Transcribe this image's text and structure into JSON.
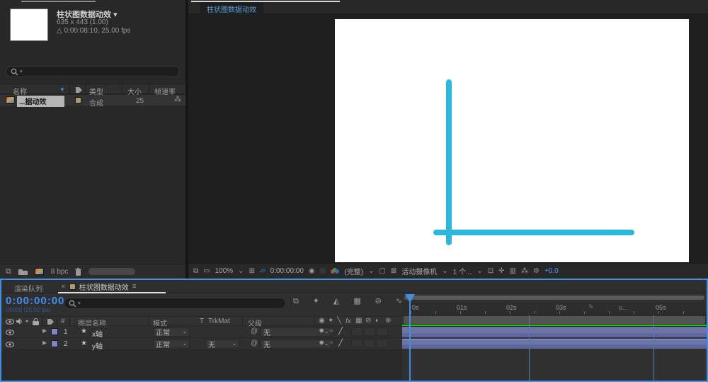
{
  "icons": {
    "caret_down": "▾",
    "chevron": "⌄",
    "sort_desc": "▼",
    "warn": "△",
    "expand": "▶",
    "star": "★",
    "pickwhip": "@",
    "hash": "#",
    "dual_view": "⧉",
    "monitor": "▭",
    "region": "⊞",
    "safe_guides": "▱",
    "snapshot": "◉",
    "show_snapshot": "◎",
    "box": "▢",
    "checker": "⊠",
    "roi": "⊡",
    "target": "✛",
    "columns": "▥",
    "network": "⁂",
    "gear": "⚙",
    "flowchart": "⧉",
    "draft3d": "✦",
    "shy_tl": "◭",
    "frame_blend": "▦",
    "motion_blur": "⊘",
    "graph": "∿",
    "menu": "≡",
    "close": "✕",
    "quality": "╱",
    "fx": "fx",
    "adjust": "◐",
    "cube": "⊕",
    "collapse": "✸",
    "solo": "●",
    "shy_head": "◉",
    "marker_pen": "✎"
  },
  "colors": {
    "accent_blue": "#3e90e0",
    "axis_cyan": "#2bb8dc",
    "layer_bar": "#6b75aa",
    "cache_green": "#1ec41e",
    "label_tan": "#ab9b6f",
    "label_purple": "#7e86c8"
  },
  "project": {
    "title": "柱状图数据动效",
    "dims": "635 x 443 (1.00)",
    "duration": "0:00:08:10, 25.00 fps",
    "col_name": "名称",
    "col_type": "类型",
    "col_size": "大小",
    "col_fps": "帧速率",
    "item_name": "...据动效",
    "item_type": "合成",
    "item_fps": "25",
    "depth": "8 bpc"
  },
  "viewer": {
    "tab": "柱状图数据动效",
    "zoom": "100%",
    "timecode": "0:00:00:00",
    "resolution": "(完整)",
    "camera": "活动摄像机",
    "views": "1 个...",
    "exposure": "+0.0"
  },
  "timeline": {
    "tab_queue": "渲染队列",
    "tab_comp": "柱状图数据动效",
    "timecode": "0:00:00:00",
    "frames": "00000 (25.00 fps)",
    "col_layer": "图层名称",
    "col_mode": "模式",
    "col_t": "T",
    "col_trkmat": "TrkMat",
    "col_parent": "父级",
    "none": "无",
    "layers": [
      {
        "num": "1",
        "name": "x轴",
        "mode": "正常",
        "trkmat": "",
        "parent": "无"
      },
      {
        "num": "2",
        "name": "y轴",
        "mode": "正常",
        "trkmat": "无",
        "parent": "无"
      }
    ],
    "ruler": {
      "t0": "0s",
      "t1": "01s",
      "t2": "02s",
      "t3": "03s",
      "t4": "u...",
      "t5": "05s"
    }
  }
}
